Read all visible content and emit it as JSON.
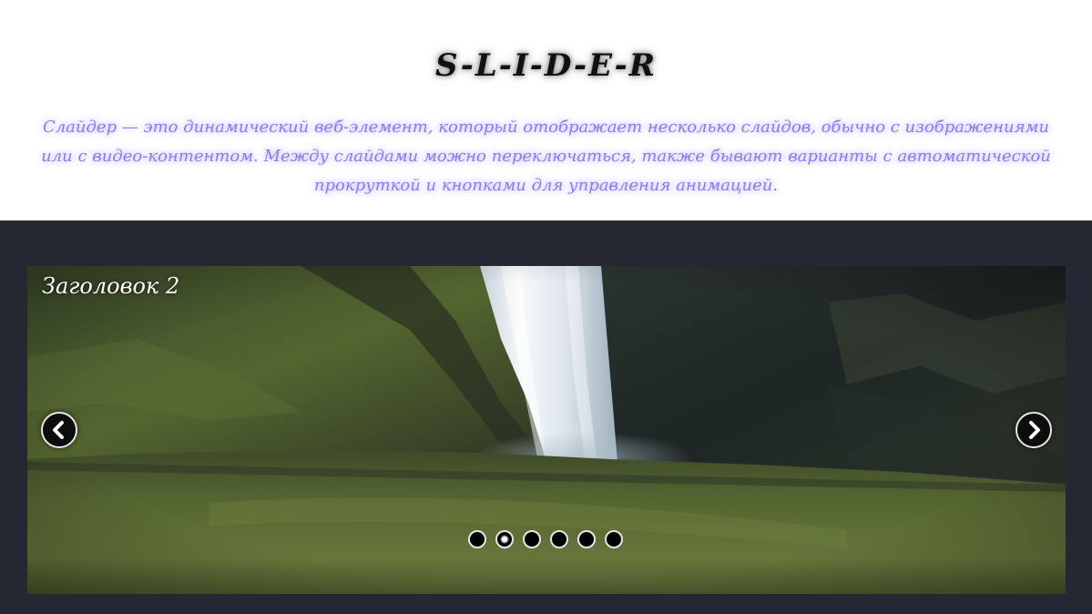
{
  "header": {
    "title": "S-L-I-D-E-R",
    "description": "Слайдер — это динамический веб-элемент, который отображает несколько слайдов, обычно с изображениями или с видео-контентом. Между слайдами можно переключаться, также бывают варианты с автоматической прокруткой и кнопками для управления анимацией."
  },
  "slider": {
    "caption": "Заголовок 2",
    "image": "waterfall-landscape",
    "slide_count": 6,
    "active_index": 1,
    "prev_icon": "chevron-left-icon",
    "next_icon": "chevron-right-icon"
  },
  "colors": {
    "page_bg": "#ffffff",
    "stage_bg": "#252833",
    "title": "#111111",
    "description": "#8c7bf0"
  }
}
